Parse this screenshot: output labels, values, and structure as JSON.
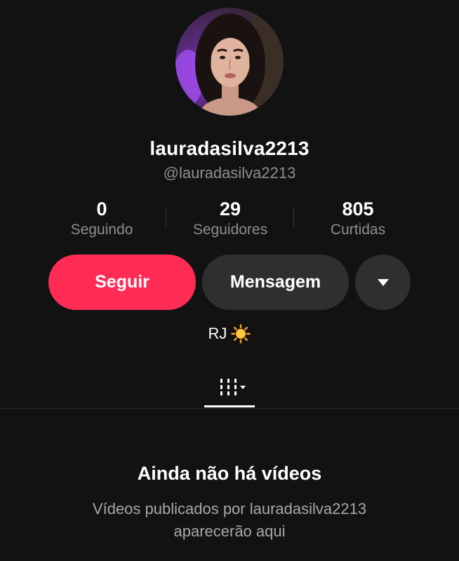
{
  "profile": {
    "display_name": "lauradasilva2213",
    "handle": "@lauradasilva2213",
    "bio": "RJ",
    "bio_emoji_icon": "sun-icon"
  },
  "stats": {
    "following": {
      "value": "0",
      "label": "Seguindo"
    },
    "followers": {
      "value": "29",
      "label": "Seguidores"
    },
    "likes": {
      "value": "805",
      "label": "Curtidas"
    }
  },
  "actions": {
    "follow_label": "Seguir",
    "message_label": "Mensagem",
    "more_icon": "caret-down-icon"
  },
  "tabs": {
    "videos_icon": "grid-columns-icon"
  },
  "empty_state": {
    "title": "Ainda não há vídeos",
    "description_line1": "Vídeos publicados por lauradasilva2213",
    "description_line2": "aparecerão aqui"
  },
  "colors": {
    "background": "#121212",
    "accent": "#fe2c55",
    "secondary_button": "#2f2f2f",
    "muted_text": "#8e8e8e"
  }
}
